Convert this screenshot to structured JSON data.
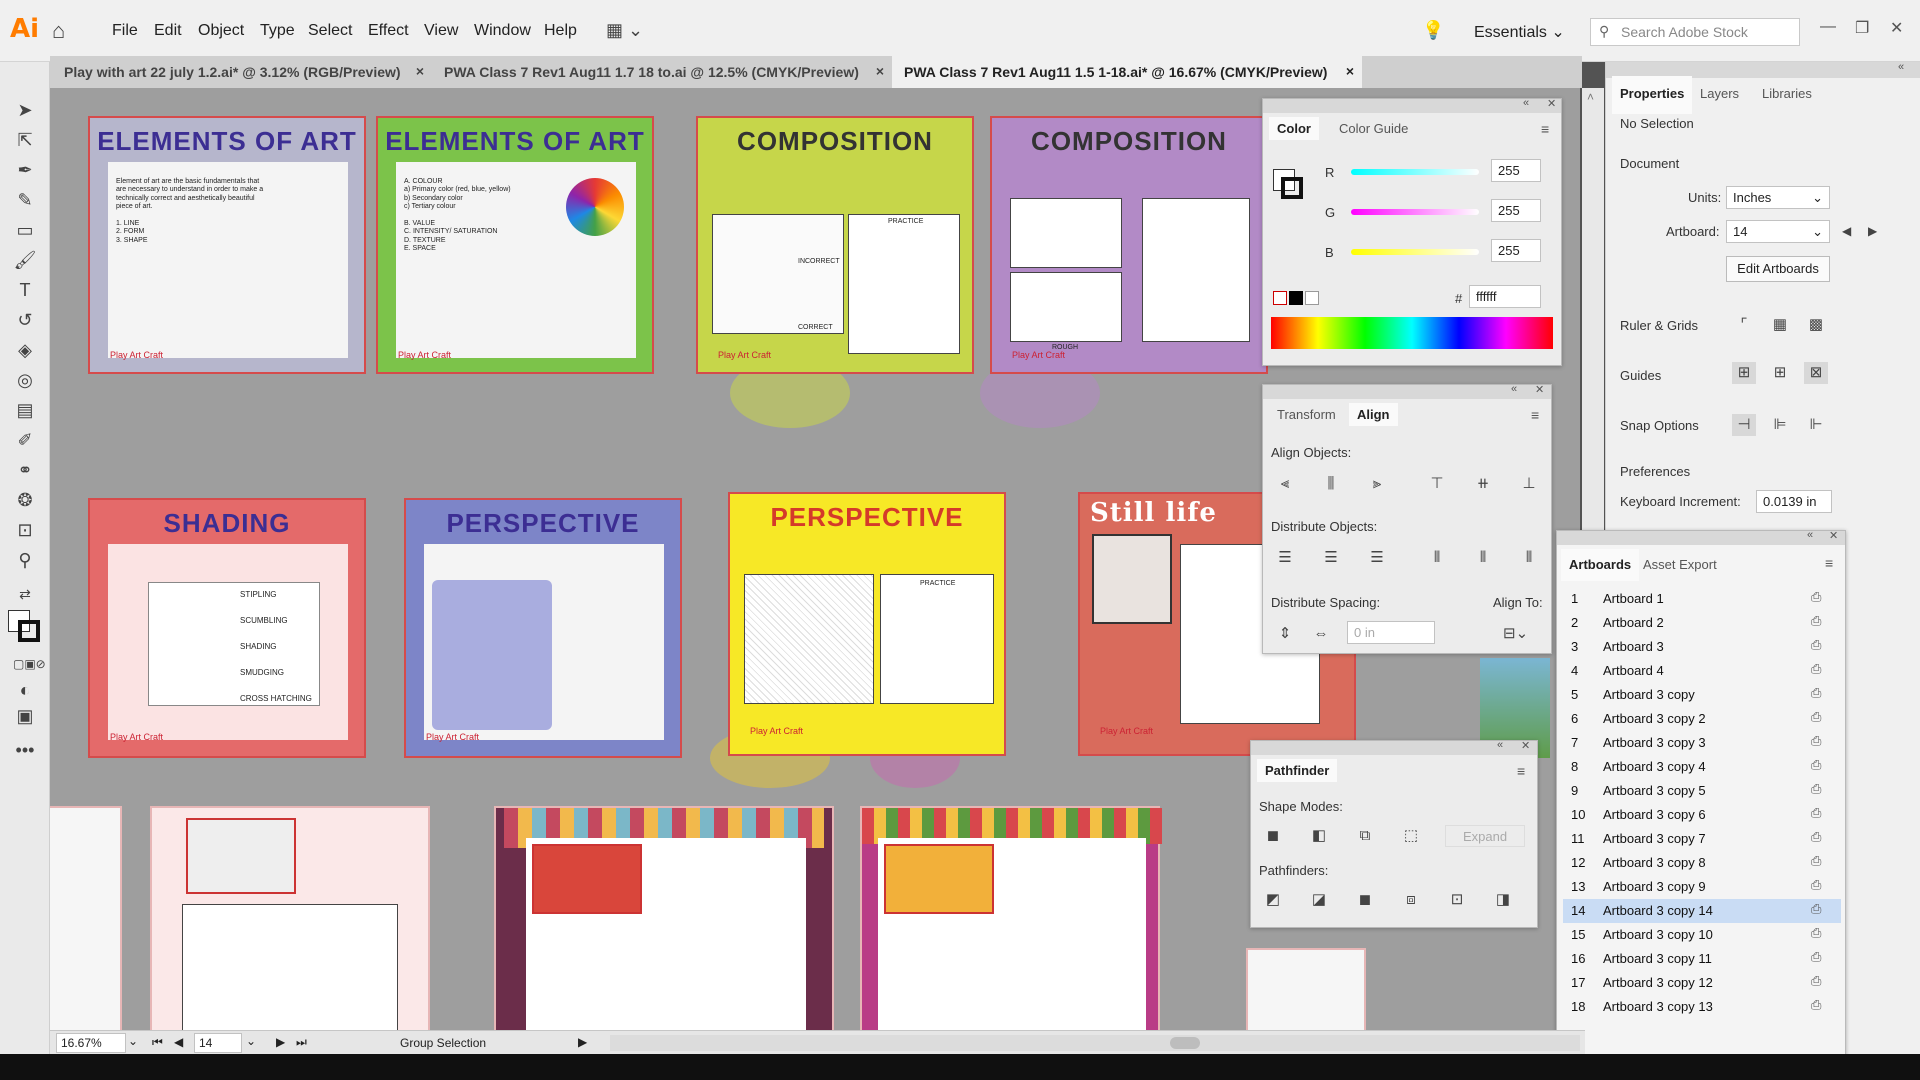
{
  "app": {
    "logo": "Ai"
  },
  "menu": {
    "items": [
      "File",
      "Edit",
      "Object",
      "Type",
      "Select",
      "Effect",
      "View",
      "Window",
      "Help"
    ]
  },
  "workspace": {
    "label": "Essentials"
  },
  "search": {
    "placeholder": "Search Adobe Stock"
  },
  "tabs": [
    {
      "label": "Play with art 22 july 1.2.ai* @ 3.12% (RGB/Preview)"
    },
    {
      "label": "PWA Class 7 Rev1 Aug11 1.7 18 to.ai @ 12.5% (CMYK/Preview)"
    },
    {
      "label": "PWA Class 7 Rev1 Aug11 1.5 1-18.ai* @ 16.67% (CMYK/Preview)"
    }
  ],
  "artboards_canvas": {
    "titles": [
      "ELEMENTS OF ART",
      "ELEMENTS OF ART",
      "COMPOSITION",
      "COMPOSITION",
      "SHADING",
      "PERSPECTIVE",
      "PERSPECTIVE",
      "Still life"
    ],
    "shading_items": [
      "STIPLING",
      "SCUMBLING",
      "SHADING",
      "SMUDGING",
      "CROSS HATCHING"
    ],
    "practice": "PRACTICE",
    "correct": "CORRECT",
    "incorrect": "INCORRECT",
    "rough": "ROUGH",
    "brand": "Play Art Craft"
  },
  "color_panel": {
    "tabs": [
      "Color",
      "Color Guide"
    ],
    "r_label": "R",
    "g_label": "G",
    "b_label": "B",
    "r": "255",
    "g": "255",
    "b": "255",
    "hash": "#",
    "hex": "ffffff"
  },
  "align_panel": {
    "tabs": [
      "Transform",
      "Align"
    ],
    "align_objects": "Align Objects:",
    "distribute_objects": "Distribute Objects:",
    "distribute_spacing": "Distribute Spacing:",
    "align_to": "Align To:",
    "spacing_value": "0 in"
  },
  "pathfinder_panel": {
    "tab": "Pathfinder",
    "shape_modes": "Shape Modes:",
    "pathfinders": "Pathfinders:",
    "expand": "Expand"
  },
  "properties": {
    "tabs": [
      "Properties",
      "Layers",
      "Libraries"
    ],
    "no_selection": "No Selection",
    "document": "Document",
    "units_label": "Units:",
    "units_value": "Inches",
    "artboard_label": "Artboard:",
    "artboard_value": "14",
    "edit_artboards": "Edit Artboards",
    "ruler_grids": "Ruler & Grids",
    "guides": "Guides",
    "snap_options": "Snap Options",
    "preferences": "Preferences",
    "keyboard_increment_label": "Keyboard Increment:",
    "keyboard_increment_value": "0.0139 in"
  },
  "artboards_panel": {
    "tabs": [
      "Artboards",
      "Asset Export"
    ],
    "rows": [
      {
        "n": "1",
        "name": "Artboard 1"
      },
      {
        "n": "2",
        "name": "Artboard 2"
      },
      {
        "n": "3",
        "name": "Artboard 3"
      },
      {
        "n": "4",
        "name": "Artboard 4"
      },
      {
        "n": "5",
        "name": "Artboard 3 copy"
      },
      {
        "n": "6",
        "name": "Artboard 3 copy 2"
      },
      {
        "n": "7",
        "name": "Artboard 3 copy 3"
      },
      {
        "n": "8",
        "name": "Artboard 3 copy 4"
      },
      {
        "n": "9",
        "name": "Artboard 3 copy 5"
      },
      {
        "n": "10",
        "name": "Artboard 3 copy 6"
      },
      {
        "n": "11",
        "name": "Artboard 3 copy 7"
      },
      {
        "n": "12",
        "name": "Artboard 3 copy 8"
      },
      {
        "n": "13",
        "name": "Artboard 3 copy 9"
      },
      {
        "n": "14",
        "name": "Artboard 3 copy 14"
      },
      {
        "n": "15",
        "name": "Artboard 3 copy 10"
      },
      {
        "n": "16",
        "name": "Artboard 3 copy 11"
      },
      {
        "n": "17",
        "name": "Artboard 3 copy 12"
      },
      {
        "n": "18",
        "name": "Artboard 3 copy 13"
      }
    ],
    "selected_index": 13
  },
  "status": {
    "zoom": "16.67%",
    "artboard_nav": "14",
    "tool": "Group Selection"
  },
  "colors": {
    "accent": "#ff7c00",
    "selection": "#c9dcf4",
    "artboard_border": "#d54b4b"
  }
}
